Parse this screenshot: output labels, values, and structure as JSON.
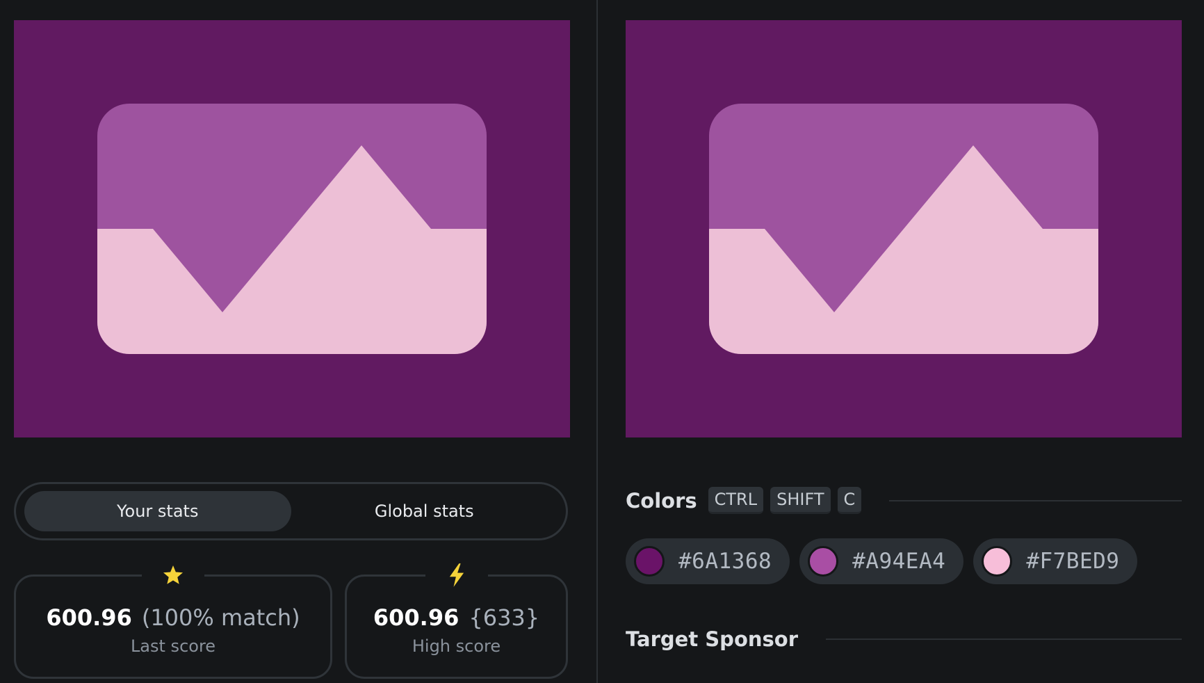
{
  "stats": {
    "tabs": [
      {
        "label": "Your stats",
        "active": true
      },
      {
        "label": "Global stats",
        "active": false
      }
    ],
    "last_score": {
      "icon": "star-icon",
      "value": "600.96",
      "extra": "(100% match)",
      "label": "Last score"
    },
    "high_score": {
      "icon": "lightning-bolt-icon",
      "value": "600.96",
      "extra": "{633}",
      "label": "High score"
    }
  },
  "colors": {
    "title": "Colors",
    "shortcut": [
      "CTRL",
      "SHIFT",
      "C"
    ],
    "swatches": [
      {
        "hex": "#6A1368"
      },
      {
        "hex": "#A94EA4"
      },
      {
        "hex": "#F7BED9"
      }
    ]
  },
  "sponsor": {
    "title": "Target Sponsor"
  },
  "theme": {
    "canvas_background": "#611A61",
    "shape_mid": "#9E539F",
    "shape_light": "#EDBFD6",
    "icon_accent": "#F5D33A"
  }
}
